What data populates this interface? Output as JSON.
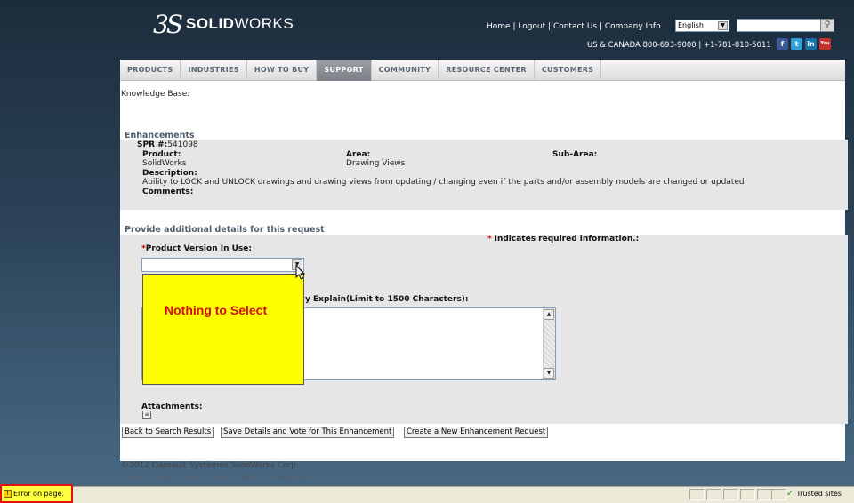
{
  "header": {
    "logo_mark": "3S",
    "logo_bold": "SOLID",
    "logo_light": "WORKS",
    "links": [
      "Home",
      "Logout",
      "Contact Us",
      "Company Info"
    ],
    "language": "English",
    "search_placeholder": "",
    "phone": "US & CANADA 800-693-9000 | +1-781-810-5011",
    "social": [
      {
        "name": "facebook-icon",
        "glyph": "f",
        "color": "#3b5998"
      },
      {
        "name": "twitter-icon",
        "glyph": "t",
        "color": "#33a0d8"
      },
      {
        "name": "linkedin-icon",
        "glyph": "in",
        "color": "#1a6fa8"
      },
      {
        "name": "youtube-icon",
        "glyph": "You",
        "color": "#c4302b"
      }
    ]
  },
  "nav": {
    "items": [
      "PRODUCTS",
      "INDUSTRIES",
      "HOW TO BUY",
      "SUPPORT",
      "COMMUNITY",
      "RESOURCE CENTER",
      "CUSTOMERS"
    ],
    "active": "SUPPORT"
  },
  "main": {
    "breadcrumb": "Knowledge Base:",
    "section_title": "Enhancements",
    "spr_label": "SPR #:",
    "spr_value": "541098",
    "product_label": "Product:",
    "product_value": "SolidWorks",
    "area_label": "Area:",
    "area_value": "Drawing Views",
    "subarea_label": "Sub-Area:",
    "description_label": "Description:",
    "description_value": "Ability to LOCK and UNLOCK drawings and drawing views from updating / changing even if the parts and/or assembly models are changed or updated",
    "comments_label": "Comments:",
    "details_title": "Provide additional details for this request",
    "required_note": "Indicates required information.:",
    "required_star": "*",
    "version_label": "Product Version In Use:",
    "explain_label": "y Explain(Limit to 1500 Characters):",
    "popup_message": "Nothing to Select",
    "attachments_label": "Attachments:"
  },
  "buttons": {
    "back": "Back to Search Results",
    "save": "Save Details and Vote for This Enhancement",
    "create": "Create a New Enhancement Request"
  },
  "footer": {
    "copyright": "©2012 Dassault Systèmes SolidWorks Corp.",
    "links": [
      "Terms of Use",
      "Privacy Policy",
      "Piracy Prevention"
    ]
  },
  "statusbar": {
    "error_text": "Error on page.",
    "zone_text": "Trusted sites"
  },
  "colors": {
    "accent_red": "#cc0000",
    "popup_bg": "#ffff00",
    "section_text": "#4f5f6f"
  }
}
